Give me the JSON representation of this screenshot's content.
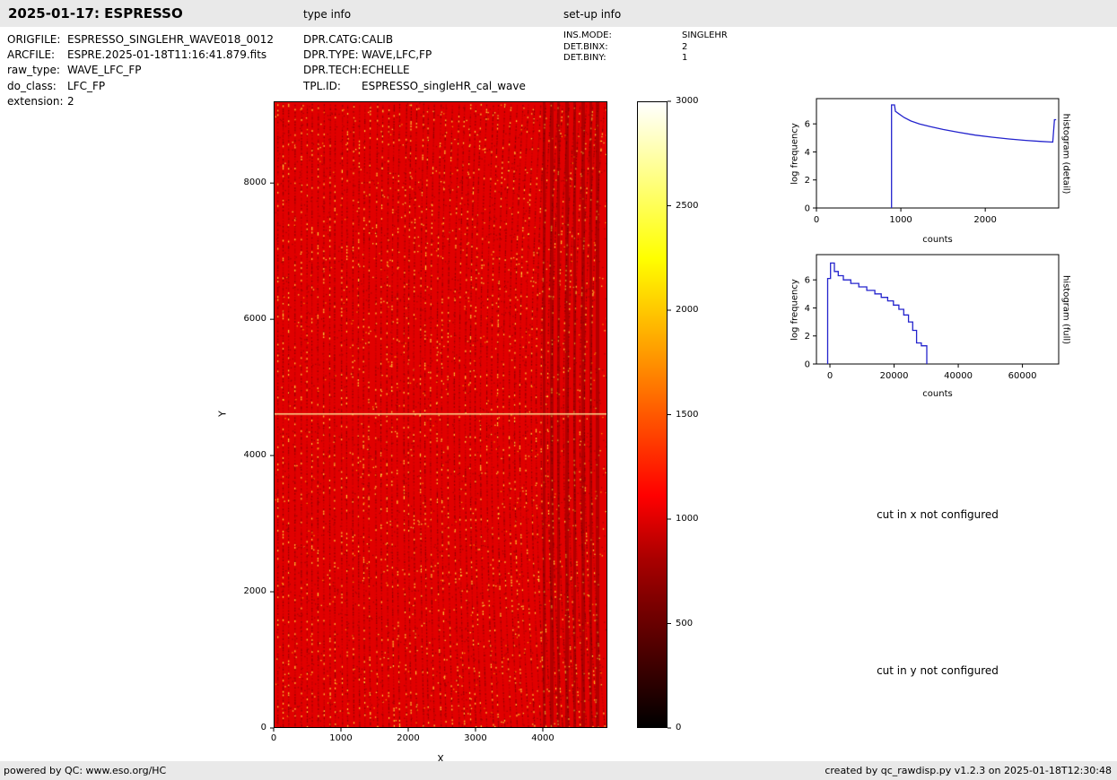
{
  "header": {
    "title": "2025-01-17: ESPRESSO",
    "type_info_label": "type info",
    "setup_info_label": "set-up info"
  },
  "file_info": {
    "rows": [
      {
        "label": "ORIGFILE:",
        "value": "ESPRESSO_SINGLEHR_WAVE018_0012"
      },
      {
        "label": "ARCFILE:",
        "value": "ESPRE.2025-01-18T11:16:41.879.fits"
      },
      {
        "label": "raw_type:",
        "value": "WAVE_LFC_FP"
      },
      {
        "label": "do_class:",
        "value": "LFC_FP"
      },
      {
        "label": "extension:",
        "value": "2"
      }
    ]
  },
  "type_info": {
    "rows": [
      {
        "label": "DPR.CATG:",
        "value": "CALIB"
      },
      {
        "label": "DPR.TYPE:",
        "value": "WAVE,LFC,FP"
      },
      {
        "label": "DPR.TECH:",
        "value": "ECHELLE"
      },
      {
        "label": "TPL.ID:",
        "value": "ESPRESSO_singleHR_cal_wave"
      }
    ]
  },
  "setup_info": {
    "rows": [
      {
        "label": "INS.MODE:",
        "value": "SINGLEHR"
      },
      {
        "label": "DET.BINX:",
        "value": "2"
      },
      {
        "label": "DET.BINY:",
        "value": "1"
      }
    ]
  },
  "messages": {
    "cut_x": "cut in x not configured",
    "cut_y": "cut in y not configured"
  },
  "footer": {
    "left": "powered by QC: www.eso.org/HC",
    "right": "created by qc_rawdisp.py v1.2.3 on 2025-01-18T12:30:48"
  },
  "chart_data": [
    {
      "type": "heatmap",
      "name": "raw frame display",
      "xlabel": "X",
      "ylabel": "Y",
      "xlim": [
        0,
        4960
      ],
      "ylim": [
        0,
        9200
      ],
      "xticks": [
        0,
        1000,
        2000,
        3000,
        4000
      ],
      "yticks": [
        0,
        2000,
        4000,
        6000,
        8000
      ],
      "colormap": "hot",
      "description": "Raw ESPRESSO LFC/FP echelle frame: ~1000-count red background with dotted curved spectral-order columns, sparse bright yellow emission dots, darker vertical bands near the right edge and one bright horizontal row near y=4600"
    },
    {
      "type": "colorbar",
      "range": [
        0,
        3000
      ],
      "ticks": [
        0,
        500,
        1000,
        1500,
        2000,
        2500,
        3000
      ],
      "gradient_stops": [
        [
          0,
          "#000000"
        ],
        [
          0.37,
          "#ff0000"
        ],
        [
          0.75,
          "#ffff00"
        ],
        [
          1,
          "#ffffff"
        ]
      ]
    },
    {
      "type": "line",
      "name": "histogram (detail)",
      "right_label": "histogram (detail)",
      "xlabel": "counts",
      "ylabel": "log frequency",
      "xlim": [
        0,
        2870
      ],
      "ylim": [
        0,
        7.8
      ],
      "xticks": [
        0,
        1000,
        2000
      ],
      "yticks": [
        0,
        2,
        4,
        6
      ],
      "color": "#2323cd",
      "points": [
        [
          890,
          0
        ],
        [
          890,
          7.35
        ],
        [
          925,
          7.35
        ],
        [
          935,
          6.9
        ],
        [
          980,
          6.7
        ],
        [
          1040,
          6.45
        ],
        [
          1120,
          6.2
        ],
        [
          1220,
          6.0
        ],
        [
          1350,
          5.8
        ],
        [
          1500,
          5.6
        ],
        [
          1680,
          5.4
        ],
        [
          1880,
          5.2
        ],
        [
          2080,
          5.05
        ],
        [
          2280,
          4.92
        ],
        [
          2480,
          4.82
        ],
        [
          2650,
          4.75
        ],
        [
          2800,
          4.7
        ],
        [
          2820,
          6.3
        ],
        [
          2840,
          6.3
        ]
      ]
    },
    {
      "type": "line",
      "name": "histogram (full)",
      "right_label": "histogram (full)",
      "xlabel": "counts",
      "ylabel": "log frequency",
      "xlim": [
        -4200,
        71300
      ],
      "ylim": [
        0,
        7.8
      ],
      "xticks": [
        0,
        20000,
        40000,
        60000
      ],
      "yticks": [
        0,
        2,
        4,
        6
      ],
      "color": "#2323cd",
      "points": [
        [
          -700,
          0
        ],
        [
          -700,
          6.1
        ],
        [
          200,
          6.1
        ],
        [
          200,
          7.2
        ],
        [
          1400,
          7.2
        ],
        [
          1400,
          6.6
        ],
        [
          2600,
          6.6
        ],
        [
          2600,
          6.3
        ],
        [
          4200,
          6.3
        ],
        [
          4200,
          6.0
        ],
        [
          6500,
          6.0
        ],
        [
          6500,
          5.75
        ],
        [
          9000,
          5.75
        ],
        [
          9000,
          5.5
        ],
        [
          11500,
          5.5
        ],
        [
          11500,
          5.25
        ],
        [
          14000,
          5.25
        ],
        [
          14000,
          5.0
        ],
        [
          16000,
          5.0
        ],
        [
          16000,
          4.75
        ],
        [
          18000,
          4.75
        ],
        [
          18000,
          4.5
        ],
        [
          19800,
          4.5
        ],
        [
          19800,
          4.2
        ],
        [
          21500,
          4.2
        ],
        [
          21500,
          3.9
        ],
        [
          23000,
          3.9
        ],
        [
          23000,
          3.5
        ],
        [
          24500,
          3.5
        ],
        [
          24500,
          3.0
        ],
        [
          25800,
          3.0
        ],
        [
          25800,
          2.4
        ],
        [
          27000,
          2.4
        ],
        [
          27000,
          1.5
        ],
        [
          28500,
          1.5
        ],
        [
          28500,
          1.3
        ],
        [
          30200,
          1.3
        ],
        [
          30200,
          0
        ]
      ]
    }
  ]
}
